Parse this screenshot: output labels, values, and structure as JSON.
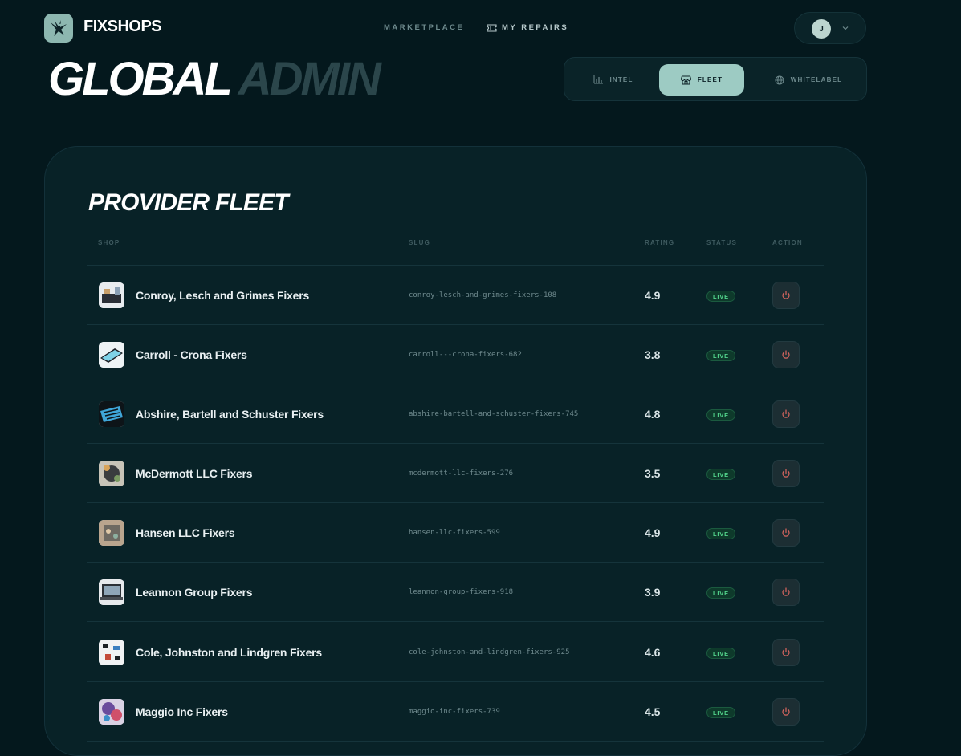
{
  "brand": {
    "name": "FIXSHOPS",
    "logo_icon": "eagle-logo-icon"
  },
  "nav": {
    "marketplace": "MARKETPLACE",
    "my_repairs": "MY REPAIRS"
  },
  "user": {
    "initial": "J"
  },
  "title": {
    "main": "GLOBAL",
    "sub": "ADMIN"
  },
  "tabs": [
    {
      "label": "INTEL",
      "icon": "bar-chart-icon",
      "active": false
    },
    {
      "label": "FLEET",
      "icon": "storefront-icon",
      "active": true
    },
    {
      "label": "WHITELABEL",
      "icon": "globe-icon",
      "active": false
    }
  ],
  "fleet": {
    "title": "PROVIDER FLEET",
    "columns": {
      "shop": "SHOP",
      "slug": "SLUG",
      "rating": "RATING",
      "status": "STATUS",
      "action": "ACTION"
    },
    "rows": [
      {
        "name": "Conroy, Lesch and Grimes Fixers",
        "slug": "conroy-lesch-and-grimes-fixers-108",
        "rating": "4.9",
        "status": "LIVE"
      },
      {
        "name": "Carroll - Crona Fixers",
        "slug": "carroll---crona-fixers-682",
        "rating": "3.8",
        "status": "LIVE"
      },
      {
        "name": "Abshire, Bartell and Schuster Fixers",
        "slug": "abshire-bartell-and-schuster-fixers-745",
        "rating": "4.8",
        "status": "LIVE"
      },
      {
        "name": "McDermott LLC Fixers",
        "slug": "mcdermott-llc-fixers-276",
        "rating": "3.5",
        "status": "LIVE"
      },
      {
        "name": "Hansen LLC Fixers",
        "slug": "hansen-llc-fixers-599",
        "rating": "4.9",
        "status": "LIVE"
      },
      {
        "name": "Leannon Group Fixers",
        "slug": "leannon-group-fixers-918",
        "rating": "3.9",
        "status": "LIVE"
      },
      {
        "name": "Cole, Johnston and Lindgren Fixers",
        "slug": "cole-johnston-and-lindgren-fixers-925",
        "rating": "4.6",
        "status": "LIVE"
      },
      {
        "name": "Maggio Inc Fixers",
        "slug": "maggio-inc-fixers-739",
        "rating": "4.5",
        "status": "LIVE"
      }
    ]
  },
  "colors": {
    "background": "#04181d",
    "accent": "#9dcbc3",
    "live": "#53d48c",
    "power": "#d9665f"
  }
}
